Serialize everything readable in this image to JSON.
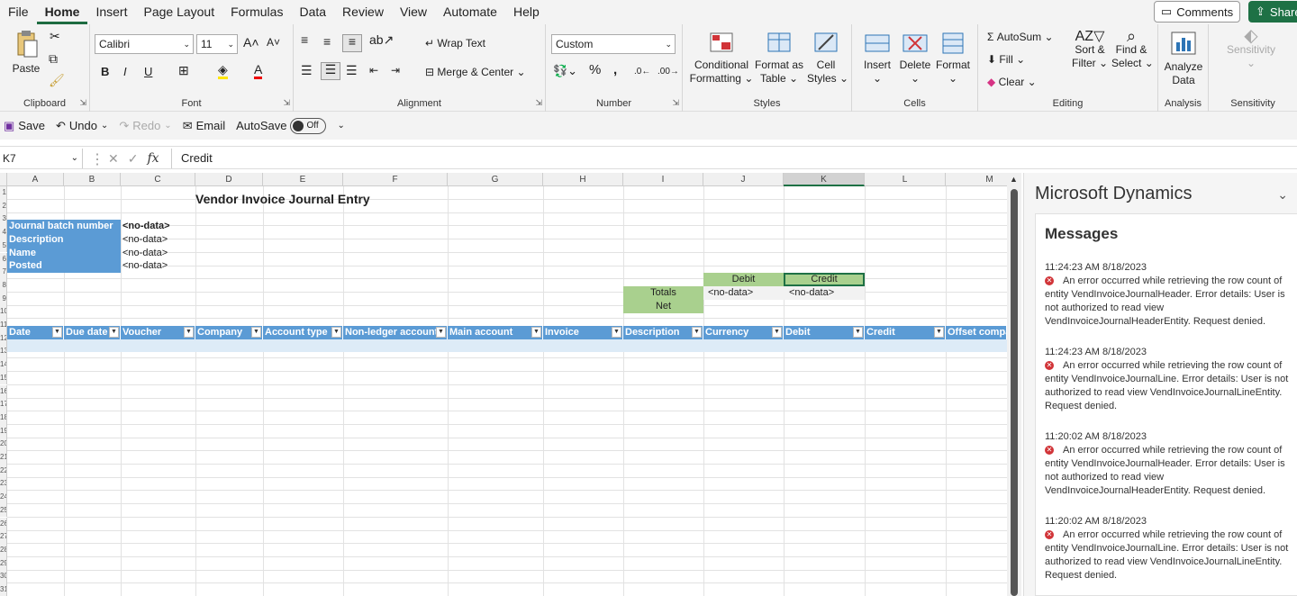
{
  "menu": {
    "items": [
      "File",
      "Home",
      "Insert",
      "Page Layout",
      "Formulas",
      "Data",
      "Review",
      "View",
      "Automate",
      "Help"
    ],
    "active": "Home"
  },
  "header": {
    "comments_label": "Comments",
    "share_label": "Share"
  },
  "ribbon": {
    "clipboard": {
      "label": "Clipboard",
      "paste": "Paste"
    },
    "font": {
      "label": "Font",
      "family": "Calibri",
      "size": "11"
    },
    "alignment": {
      "label": "Alignment",
      "wrap_text": "Wrap Text",
      "merge_center": "Merge & Center"
    },
    "number": {
      "label": "Number",
      "format": "Custom"
    },
    "styles": {
      "label": "Styles",
      "conditional": "Conditional",
      "conditional2": "Formatting",
      "format_as": "Format as",
      "format_as2": "Table",
      "cell_styles": "Cell",
      "cell_styles2": "Styles"
    },
    "cells": {
      "label": "Cells",
      "insert": "Insert",
      "delete": "Delete",
      "format": "Format"
    },
    "editing": {
      "label": "Editing",
      "autosum": "AutoSum",
      "fill": "Fill",
      "clear": "Clear",
      "sort": "Sort &",
      "sort2": "Filter",
      "find": "Find &",
      "find2": "Select"
    },
    "analysis": {
      "label": "Analysis",
      "analyze": "Analyze",
      "analyze2": "Data"
    },
    "sensitivity": {
      "label": "Sensitivity",
      "btn": "Sensitivity"
    }
  },
  "qat": {
    "save": "Save",
    "undo": "Undo",
    "redo": "Redo",
    "email": "Email",
    "autosave": "AutoSave",
    "autosave_state": "Off"
  },
  "formula_bar": {
    "name_box": "K7",
    "fx": "fx",
    "formula": "Credit"
  },
  "sheet": {
    "columns": [
      "A",
      "B",
      "C",
      "D",
      "E",
      "F",
      "G",
      "H",
      "I",
      "J",
      "K",
      "L",
      "M"
    ],
    "selected_column": "K",
    "title": "Vendor Invoice Journal Entry",
    "header_fields": [
      {
        "label": "Journal batch number",
        "value": "<no-data>"
      },
      {
        "label": "Description",
        "value": "<no-data>"
      },
      {
        "label": "Name",
        "value": "<no-data>"
      },
      {
        "label": "Posted",
        "value": "<no-data>"
      }
    ],
    "totals": {
      "debit_label": "Debit",
      "credit_label": "Credit",
      "totals_label": "Totals",
      "net_label": "Net",
      "debit_value": "<no-data>",
      "credit_value": "<no-data>"
    },
    "table_headers": [
      "Date",
      "Due date",
      "Voucher",
      "Company",
      "Account type",
      "Non-ledger account",
      "Main account",
      "Invoice",
      "Description",
      "Currency",
      "Debit",
      "Credit",
      "Offset compa"
    ],
    "row_numbers": [
      "1",
      "2",
      "3",
      "4",
      "5",
      "6",
      "7",
      "8",
      "9",
      "10",
      "11",
      "12",
      "13",
      "14",
      "15",
      "16",
      "17",
      "18",
      "19",
      "20",
      "21",
      "22",
      "23",
      "24",
      "25",
      "26",
      "27",
      "28",
      "29",
      "30",
      "31"
    ]
  },
  "pane": {
    "title": "Microsoft Dynamics",
    "messages_header": "Messages",
    "messages": [
      {
        "time": "11:24:23 AM 8/18/2023",
        "text": "An error occurred while retrieving the row count of entity VendInvoiceJournalHeader. Error details: User is not authorized to read view VendInvoiceJournalHeaderEntity.  Request denied."
      },
      {
        "time": "11:24:23 AM 8/18/2023",
        "text": "An error occurred while retrieving the row count of entity VendInvoiceJournalLine. Error details: User is not authorized to read view VendInvoiceJournalLineEntity.  Request denied."
      },
      {
        "time": "11:20:02 AM 8/18/2023",
        "text": "An error occurred while retrieving the row count of entity VendInvoiceJournalHeader. Error details: User is not authorized to read view VendInvoiceJournalHeaderEntity.  Request denied."
      },
      {
        "time": "11:20:02 AM 8/18/2023",
        "text": "An error occurred while retrieving the row count of entity VendInvoiceJournalLine. Error details: User is not authorized to read view VendInvoiceJournalLineEntity.  Request denied."
      }
    ]
  },
  "colors": {
    "accent": "#1e7145",
    "table_header": "#5b9bd5",
    "totals_green": "#a9d08e",
    "error": "#d13438"
  }
}
